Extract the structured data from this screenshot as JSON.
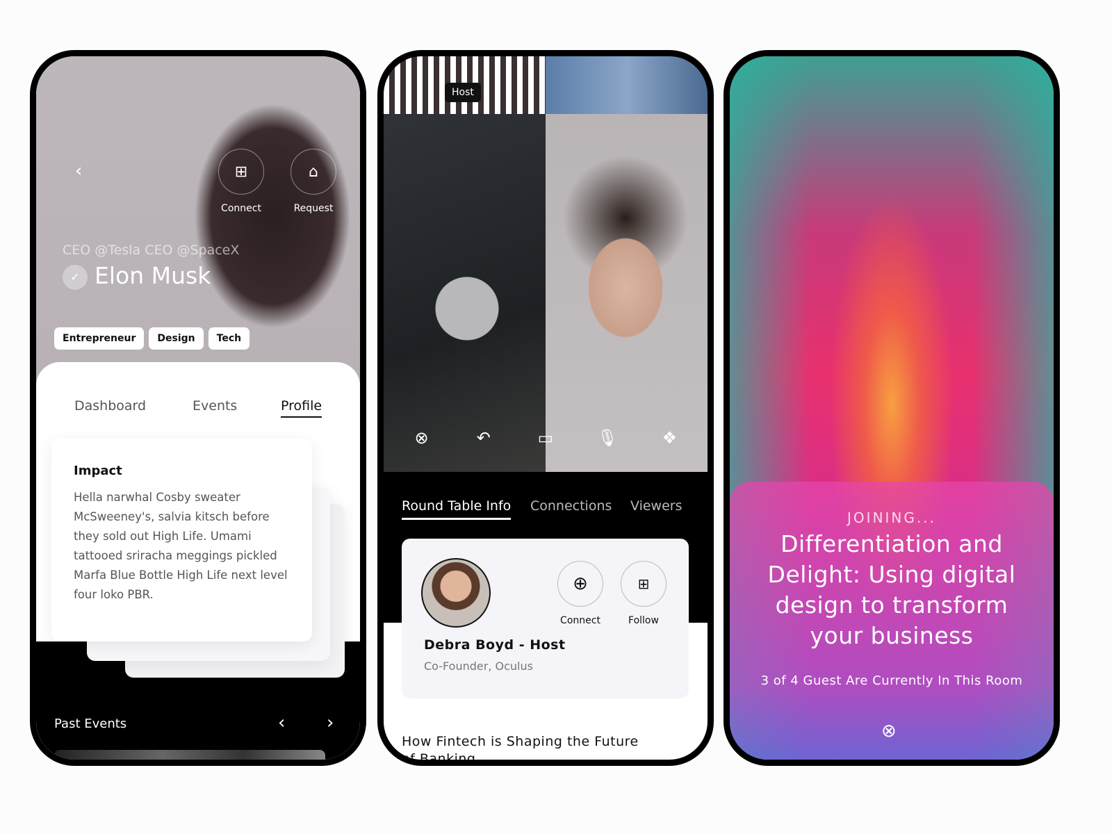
{
  "profile": {
    "back_icon": "chevron-left-icon",
    "connect_label": "Connect",
    "request_label": "Request",
    "subtitle": "CEO @Tesla CEO @SpaceX",
    "name": "Elon Musk",
    "tags": [
      "Entrepreneur",
      "Design",
      "Tech"
    ],
    "tabs": [
      "Dashboard",
      "Events",
      "Profile"
    ],
    "active_tab": "Profile",
    "impact_title": "Impact",
    "impact_text": "Hella narwhal Cosby sweater McSweeney's, salvia kitsch before they sold out High Life. Umami tattooed sriracha meggings pickled Marfa Blue Bottle High Life next level four loko PBR.",
    "past_events": "Past Events"
  },
  "room": {
    "host_badge": "Host",
    "controls": [
      "close-icon",
      "undo-icon",
      "video-icon",
      "mic-icon",
      "grid-icon"
    ],
    "tabs": [
      "Round Table Info",
      "Connections",
      "Viewers"
    ],
    "active_tab": "Round Table Info",
    "host_name": "Debra Boyd - Host",
    "host_role": "Co-Founder, Oculus",
    "connect_label": "Connect",
    "follow_label": "Follow",
    "title": "How Fintech is Shaping the Future of Banking"
  },
  "joining": {
    "status": "JOINING...",
    "title": "Differentiation and Delight: Using digital design to transform your business",
    "guests": "3 of 4 Guest Are Currently In This Room"
  }
}
